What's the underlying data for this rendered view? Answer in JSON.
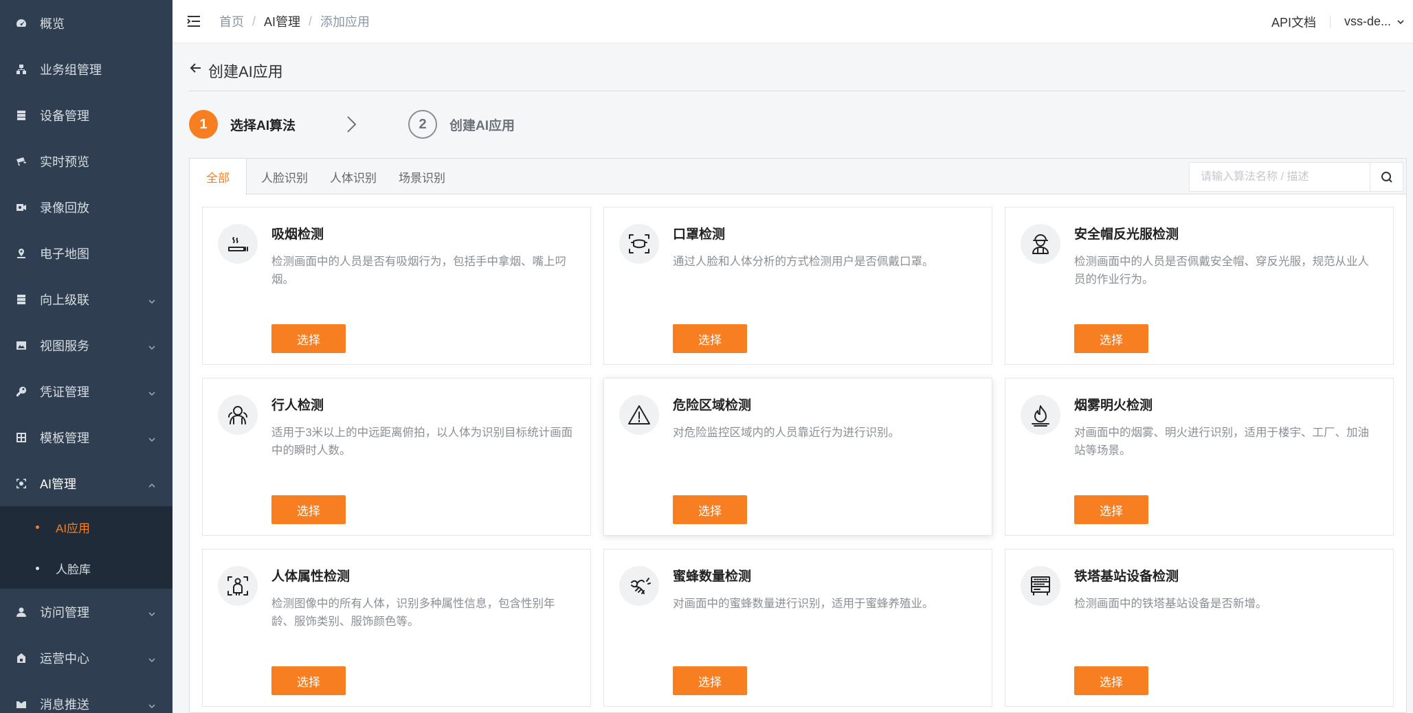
{
  "sidebar": {
    "items": [
      {
        "label": "概览",
        "icon": "dashboard-icon"
      },
      {
        "label": "业务组管理",
        "icon": "org-icon"
      },
      {
        "label": "设备管理",
        "icon": "server-icon"
      },
      {
        "label": "实时预览",
        "icon": "camera-icon"
      },
      {
        "label": "录像回放",
        "icon": "record-icon"
      },
      {
        "label": "电子地图",
        "icon": "map-icon"
      },
      {
        "label": "向上级联",
        "icon": "cascade-icon"
      },
      {
        "label": "视图服务",
        "icon": "image-icon"
      },
      {
        "label": "凭证管理",
        "icon": "key-icon"
      },
      {
        "label": "模板管理",
        "icon": "template-icon"
      },
      {
        "label": "AI管理",
        "icon": "ai-icon"
      },
      {
        "label": "访问管理",
        "icon": "user-icon"
      },
      {
        "label": "运营中心",
        "icon": "operations-icon"
      },
      {
        "label": "消息推送",
        "icon": "message-icon"
      }
    ],
    "submenu": [
      {
        "label": "AI应用",
        "active": true
      },
      {
        "label": "人脸库",
        "active": false
      }
    ]
  },
  "topbar": {
    "breadcrumb": [
      "首页",
      "AI管理",
      "添加应用"
    ],
    "api_docs": "API文档",
    "user": "vss-de..."
  },
  "page": {
    "title": "创建AI应用"
  },
  "steps": [
    {
      "number": "1",
      "label": "选择AI算法"
    },
    {
      "number": "2",
      "label": "创建AI应用"
    }
  ],
  "tabs": [
    "全部",
    "人脸识别",
    "人体识别",
    "场景识别"
  ],
  "search": {
    "placeholder": "请输入算法名称 / 描述"
  },
  "select_label": "选择",
  "cards": [
    {
      "title": "吸烟检测",
      "desc": "检测画面中的人员是否有吸烟行为，包括手中拿烟、嘴上叼烟。",
      "icon": "smoking-icon"
    },
    {
      "title": "口罩检测",
      "desc": "通过人脸和人体分析的方式检测用户是否佩戴口罩。",
      "icon": "mask-icon"
    },
    {
      "title": "安全帽反光服检测",
      "desc": "检测画面中的人员是否佩戴安全帽、穿反光服，规范从业人员的作业行为。",
      "icon": "helmet-icon"
    },
    {
      "title": "行人检测",
      "desc": "适用于3米以上的中远距离俯拍，以人体为识别目标统计画面中的瞬时人数。",
      "icon": "pedestrian-icon"
    },
    {
      "title": "危险区域检测",
      "desc": "对危险监控区域内的人员靠近行为进行识别。",
      "icon": "warning-icon"
    },
    {
      "title": "烟雾明火检测",
      "desc": "对画面中的烟雾、明火进行识别，适用于楼宇、工厂、加油站等场景。",
      "icon": "fire-icon"
    },
    {
      "title": "人体属性检测",
      "desc": "检测图像中的所有人体，识别多种属性信息，包含性别年龄、服饰类别、服饰颜色等。",
      "icon": "body-attribute-icon"
    },
    {
      "title": "蜜蜂数量检测",
      "desc": "对画面中的蜜蜂数量进行识别，适用于蜜蜂养殖业。",
      "icon": "bee-icon"
    },
    {
      "title": "铁塔基站设备检测",
      "desc": "检测画面中的铁塔基站设备是否新增。",
      "icon": "tower-device-icon"
    }
  ],
  "colors": {
    "accent": "#f77f22",
    "sidebar_bg": "#2f3e50",
    "submenu_bg": "#1f2b38"
  }
}
